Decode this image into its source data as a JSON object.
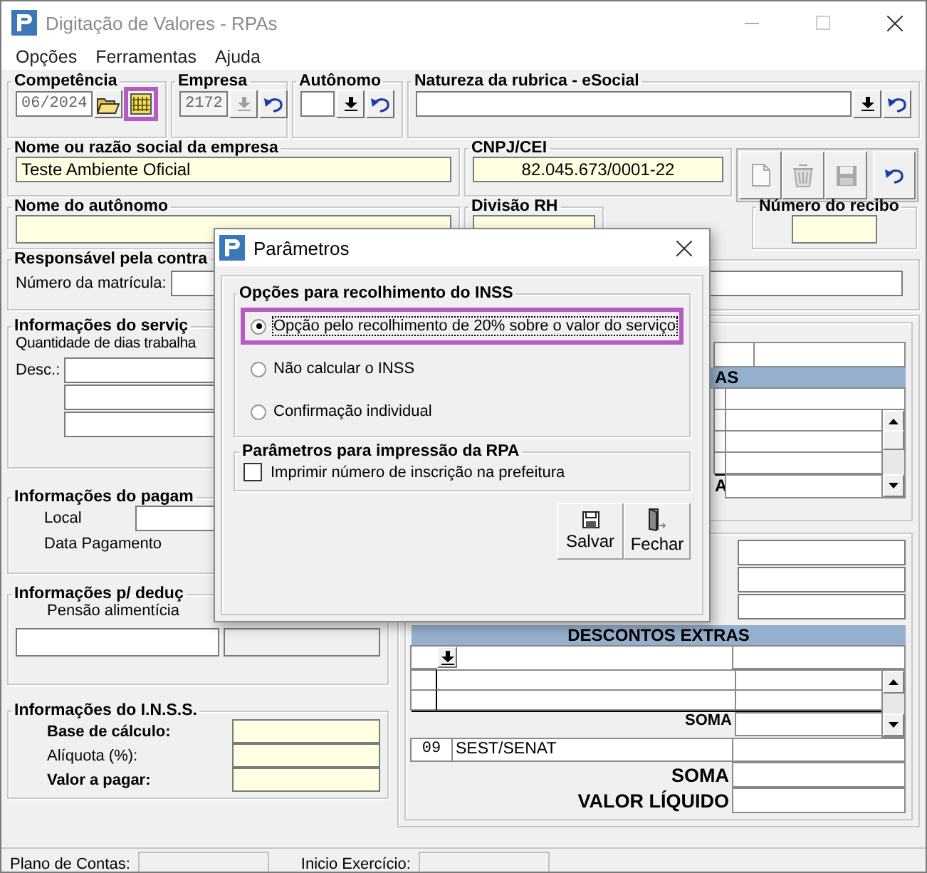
{
  "window": {
    "title": "Digitação de Valores - RPAs"
  },
  "menu": [
    "Opções",
    "Ferramentas",
    "Ajuda"
  ],
  "competencia": {
    "label": "Competência",
    "value": "06/2024",
    "calendar_highlighted": true
  },
  "empresa": {
    "label": "Empresa",
    "value": "2172",
    "disabled": true
  },
  "autonomo": {
    "label": "Autônomo"
  },
  "natureza": {
    "label": "Natureza da rubrica - eSocial"
  },
  "empresa_nome": {
    "label": "Nome ou razão social da empresa",
    "value": "Teste Ambiente Oficial"
  },
  "cnpj": {
    "label": "CNPJ/CEI",
    "value": "82.045.673/0001-22"
  },
  "toolbar": [
    {
      "kind": "new",
      "disabled": true
    },
    {
      "kind": "delete",
      "disabled": true
    },
    {
      "kind": "save",
      "disabled": true
    },
    {
      "kind": "undo",
      "disabled": false
    }
  ],
  "nome_autonomo": {
    "label": "Nome do autônomo"
  },
  "divisao": {
    "label": "Divisão RH"
  },
  "recibo": {
    "label": "Número do recibo"
  },
  "responsavel": {
    "label": "Responsável pela contra",
    "matricula_label": "Número da matrícula:"
  },
  "servico": {
    "label": "Informações do serviç",
    "dias_label": "Quantidade de dias trabalha",
    "desc_label": "Desc.:"
  },
  "pagamento": {
    "label": "Informações do pagam",
    "local_label": "Local",
    "data_label": "Data Pagamento"
  },
  "deducoes": {
    "label": "Informações p/ deduç",
    "pensao_label": "Pensão alimentícia"
  },
  "inss": {
    "label": "Informações do I.N.S.S.",
    "rows": [
      {
        "label": "Base de cálculo:",
        "bold": true
      },
      {
        "label": "Alíquota (%):",
        "bold": false
      },
      {
        "label": "Valor a pagar:",
        "bold": true
      }
    ]
  },
  "grid_upper": {
    "header": "AS",
    "total_label": "A"
  },
  "descontos": {
    "header": "DESCONTOS EXTRAS",
    "soma_label": "SOMA",
    "rows": [
      {
        "code": "09",
        "name": "SEST/SENAT"
      }
    ]
  },
  "totals": [
    {
      "label": "SOMA"
    },
    {
      "label": "VALOR LÍQUIDO"
    }
  ],
  "status": [
    {
      "label": "Plano de Contas:"
    },
    {
      "label": "Inicio Exercício:"
    }
  ],
  "dialog": {
    "title": "Parâmetros",
    "inss_group": "Opções para recolhimento do INSS",
    "options": [
      {
        "label": "Opção pelo recolhimento de 20% sobre o valor do serviço",
        "selected": true,
        "highlighted": true,
        "focused": true
      },
      {
        "label": "Não calcular o INSS",
        "selected": false,
        "highlighted": false,
        "focused": false
      },
      {
        "label": "Confirmação individual",
        "selected": false,
        "highlighted": false,
        "focused": false
      }
    ],
    "print_group": "Parâmetros para impressão da RPA",
    "print_option": {
      "label": "Imprimir número de inscrição na prefeitura",
      "checked": false
    },
    "buttons": [
      {
        "label": "Salvar",
        "kind": "save"
      },
      {
        "label": "Fechar",
        "kind": "exit"
      }
    ]
  }
}
